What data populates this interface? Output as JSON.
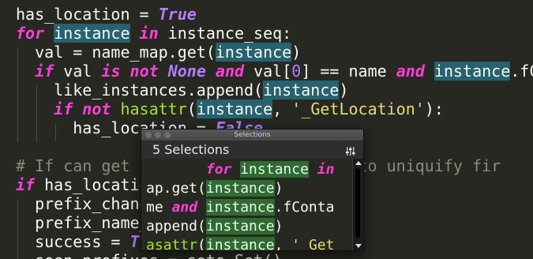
{
  "code_lines": [
    {
      "segments": [
        {
          "text": "has_location = ",
          "cls": ""
        },
        {
          "text": "True",
          "cls": "const"
        }
      ]
    },
    {
      "segments": [
        {
          "text": "for ",
          "cls": "kw"
        },
        {
          "text": "instance",
          "cls": "hl"
        },
        {
          "text": " ",
          "cls": ""
        },
        {
          "text": "in",
          "cls": "kw"
        },
        {
          "text": " instance_seq:",
          "cls": ""
        }
      ]
    },
    {
      "segments": [
        {
          "text": "  val = name_map.get(",
          "cls": ""
        },
        {
          "text": "instance",
          "cls": "hl"
        },
        {
          "text": ")",
          "cls": ""
        }
      ]
    },
    {
      "segments": [
        {
          "text": "  ",
          "cls": ""
        },
        {
          "text": "if",
          "cls": "kw"
        },
        {
          "text": " val ",
          "cls": ""
        },
        {
          "text": "is not",
          "cls": "kw"
        },
        {
          "text": " ",
          "cls": ""
        },
        {
          "text": "None",
          "cls": "const"
        },
        {
          "text": " ",
          "cls": ""
        },
        {
          "text": "and",
          "cls": "kw"
        },
        {
          "text": " val[",
          "cls": ""
        },
        {
          "text": "0",
          "cls": "num"
        },
        {
          "text": "] == name ",
          "cls": ""
        },
        {
          "text": "and",
          "cls": "kw"
        },
        {
          "text": " ",
          "cls": ""
        },
        {
          "text": "instance",
          "cls": "hl"
        },
        {
          "text": ".fCo",
          "cls": ""
        }
      ]
    },
    {
      "segments": [
        {
          "text": "    like_instances.append(",
          "cls": ""
        },
        {
          "text": "instance",
          "cls": "hl"
        },
        {
          "text": ")",
          "cls": ""
        }
      ]
    },
    {
      "segments": [
        {
          "text": "    ",
          "cls": ""
        },
        {
          "text": "if not",
          "cls": "kw"
        },
        {
          "text": " ",
          "cls": ""
        },
        {
          "text": "hasattr",
          "cls": "fn"
        },
        {
          "text": "(",
          "cls": ""
        },
        {
          "text": "instance",
          "cls": "hl"
        },
        {
          "text": ", ",
          "cls": ""
        },
        {
          "text": "'_GetLocation'",
          "cls": "str"
        },
        {
          "text": "):",
          "cls": ""
        }
      ]
    },
    {
      "segments": [
        {
          "text": "      has_location = ",
          "cls": ""
        },
        {
          "text": "False",
          "cls": "const"
        }
      ]
    },
    {
      "segments": [
        {
          "text": "",
          "cls": ""
        }
      ]
    },
    {
      "segments": [
        {
          "text": "# If can get l",
          "cls": "cmt"
        },
        {
          "text": "                  ",
          "cls": ""
        },
        {
          "text": "try to uniquify fir",
          "cls": "cmt"
        }
      ]
    },
    {
      "segments": [
        {
          "text": "if",
          "cls": "kw"
        },
        {
          "text": " has_locatio",
          "cls": ""
        }
      ]
    },
    {
      "segments": [
        {
          "text": "  prefix_chang",
          "cls": ""
        }
      ]
    },
    {
      "segments": [
        {
          "text": "  prefix_name_",
          "cls": ""
        }
      ]
    },
    {
      "segments": [
        {
          "text": "  success = ",
          "cls": ""
        },
        {
          "text": "Tr",
          "cls": "const"
        }
      ]
    },
    {
      "segments": [
        {
          "text": "  seen_prefixes = sets.Set()",
          "cls": ""
        }
      ]
    }
  ],
  "popup": {
    "window_title": "Selections",
    "count_label": "5 Selections",
    "menu_icon": "sliders-icon",
    "list_lines": [
      {
        "segments": [
          {
            "text": "       ",
            "cls": ""
          },
          {
            "text": "for",
            "cls": "kw"
          },
          {
            "text": " ",
            "cls": ""
          },
          {
            "text": "instance",
            "cls": "hlg"
          },
          {
            "text": " ",
            "cls": ""
          },
          {
            "text": "in",
            "cls": "kw"
          }
        ]
      },
      {
        "segments": [
          {
            "text": "ap.get(",
            "cls": ""
          },
          {
            "text": "instance",
            "cls": "hlg"
          },
          {
            "text": ")",
            "cls": ""
          }
        ]
      },
      {
        "segments": [
          {
            "text": "me ",
            "cls": ""
          },
          {
            "text": "and",
            "cls": "kw"
          },
          {
            "text": " ",
            "cls": ""
          },
          {
            "text": "instance",
            "cls": "hlg"
          },
          {
            "text": ".fConta",
            "cls": ""
          }
        ]
      },
      {
        "segments": [
          {
            "text": "append(",
            "cls": ""
          },
          {
            "text": "instance",
            "cls": "hlg"
          },
          {
            "text": ")",
            "cls": ""
          }
        ]
      },
      {
        "segments": [
          {
            "text": "asattr",
            "cls": "fn"
          },
          {
            "text": "(",
            "cls": ""
          },
          {
            "text": "instance",
            "cls": "hlg"
          },
          {
            "text": ", ",
            "cls": ""
          },
          {
            "text": "'_Get",
            "cls": "str"
          }
        ]
      }
    ]
  },
  "colors": {
    "background": "#272822",
    "keyword": "#ff3fd8",
    "constant": "#b57cff",
    "function": "#a6e22e",
    "string": "#e6db74",
    "comment": "#8a8a80",
    "selection_highlight": "#26626f",
    "list_highlight": "#2f6b32"
  }
}
